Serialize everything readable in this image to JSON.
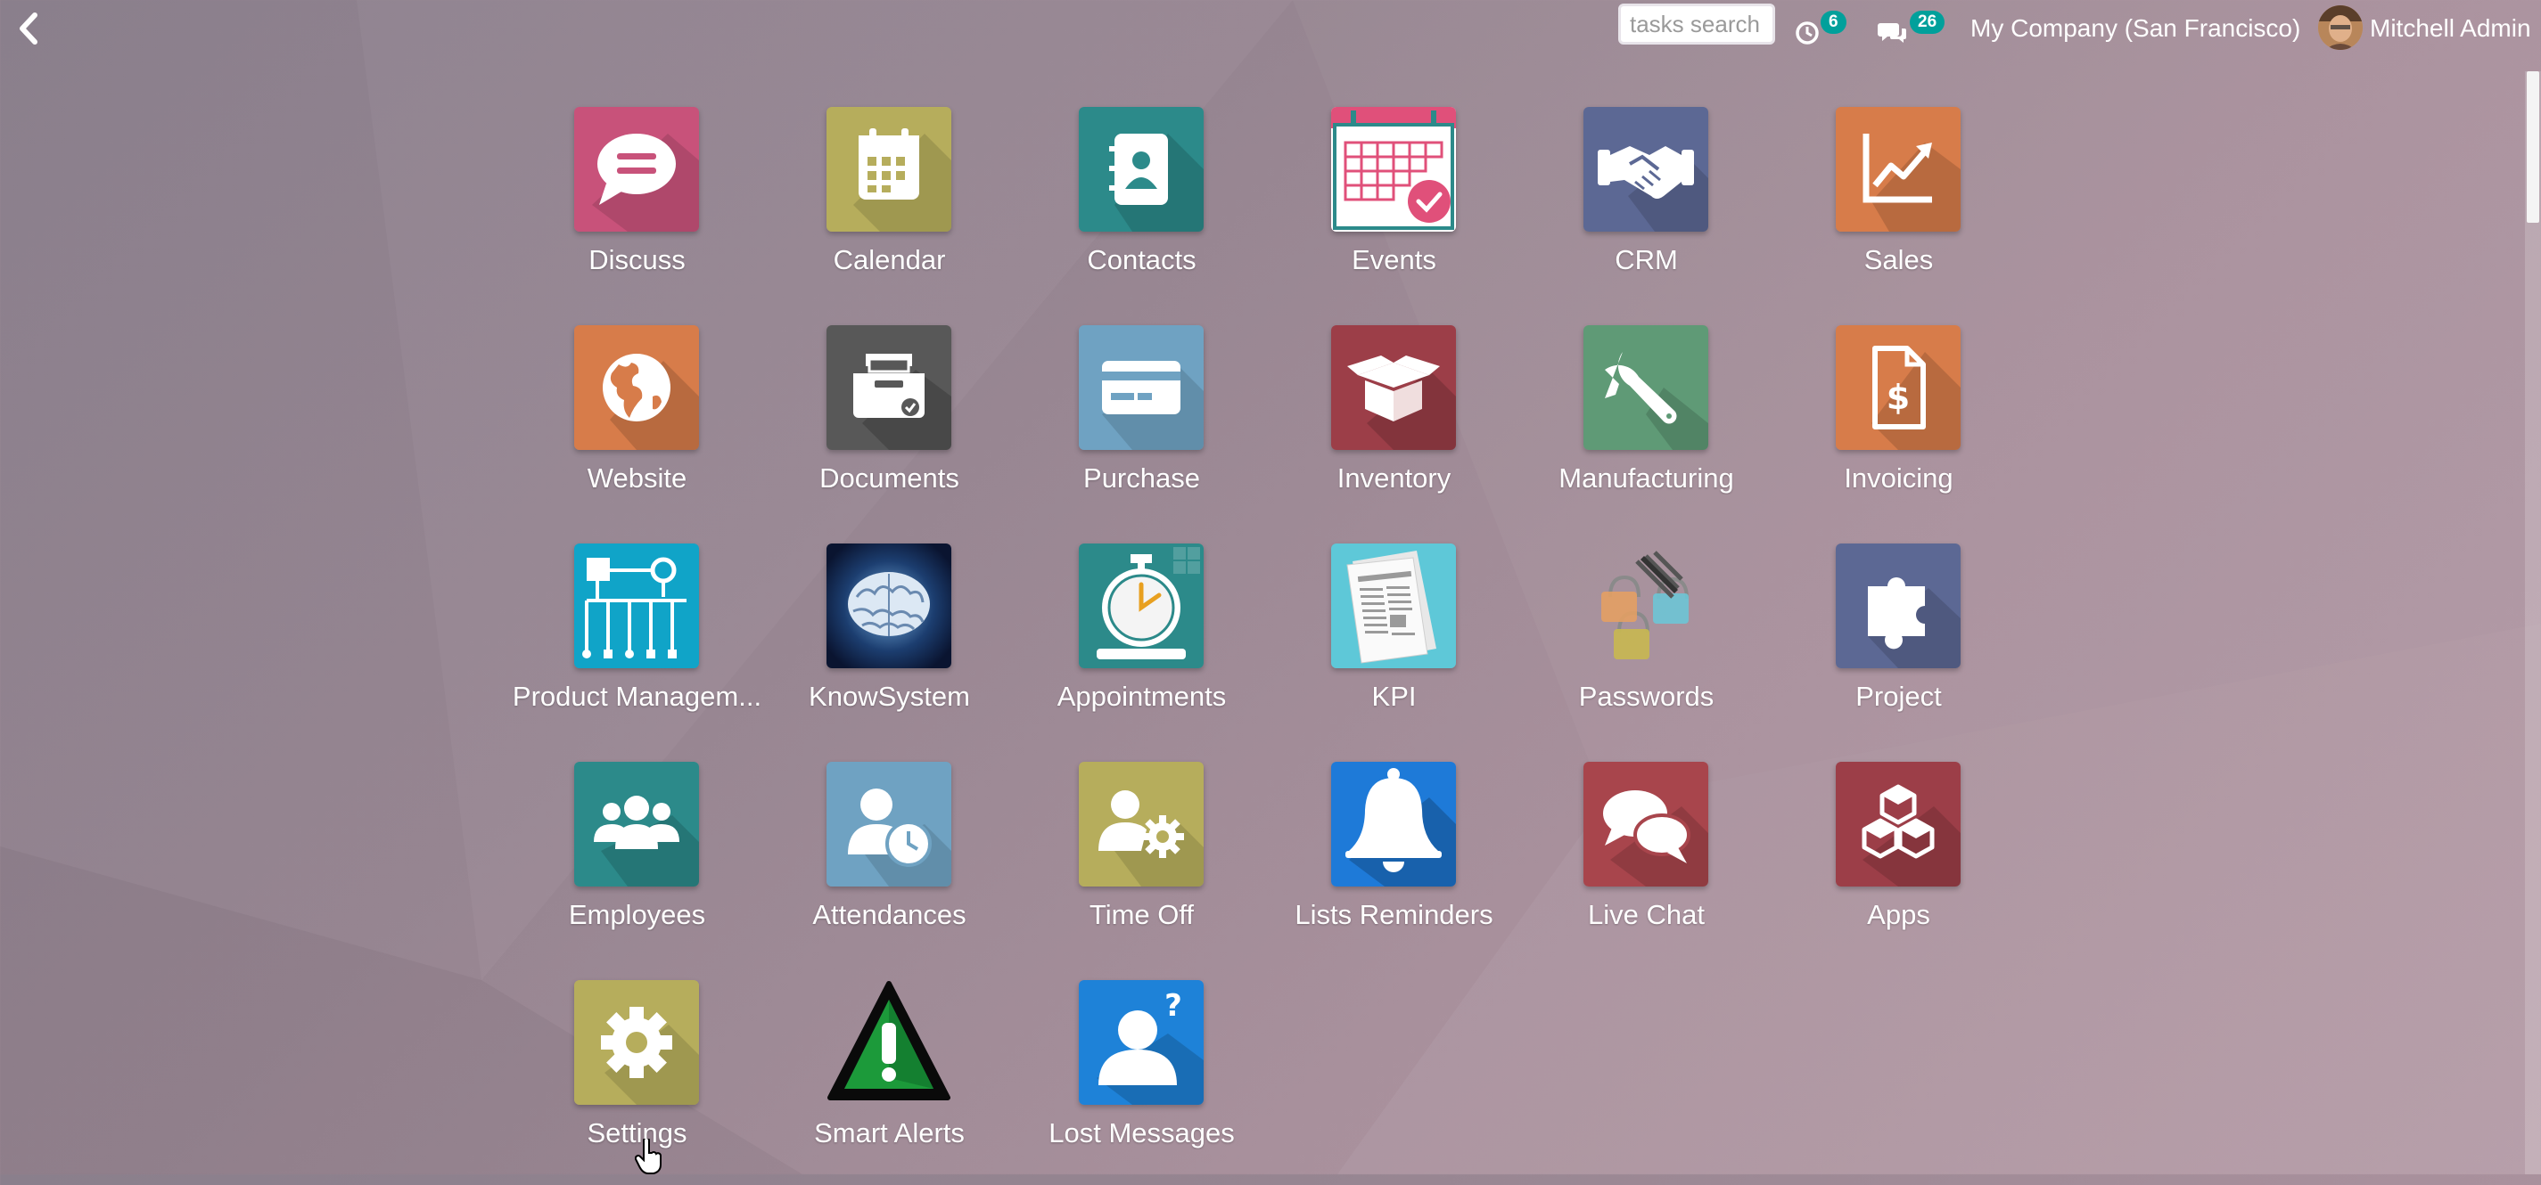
{
  "topbar": {
    "back_icon": "chevron-left-icon",
    "search": {
      "placeholder": "tasks search",
      "value": ""
    },
    "activity": {
      "icon": "clock-icon",
      "count": "6"
    },
    "messages": {
      "icon": "chat-bubbles-icon",
      "count": "26"
    },
    "company": "My Company (San Francisco)",
    "user": "Mitchell Admin"
  },
  "apps": [
    {
      "label": "Discuss",
      "icon": "chat-bubble-icon",
      "color": "#c8527a"
    },
    {
      "label": "Calendar",
      "icon": "calendar-icon",
      "color": "#b6ad5c"
    },
    {
      "label": "Contacts",
      "icon": "address-book-icon",
      "color": "#2c8a8a"
    },
    {
      "label": "Events",
      "icon": "event-calendar-icon",
      "color": "#ffffff"
    },
    {
      "label": "CRM",
      "icon": "handshake-icon",
      "color": "#5c6894"
    },
    {
      "label": "Sales",
      "icon": "trend-chart-icon",
      "color": "#d77c4a"
    },
    {
      "label": "Website",
      "icon": "globe-icon",
      "color": "#d77c4a"
    },
    {
      "label": "Documents",
      "icon": "inbox-tray-icon",
      "color": "#585858"
    },
    {
      "label": "Purchase",
      "icon": "credit-card-icon",
      "color": "#6fa2c2"
    },
    {
      "label": "Inventory",
      "icon": "box-icon",
      "color": "#9c3e48"
    },
    {
      "label": "Manufacturing",
      "icon": "wrench-icon",
      "color": "#5f9a76"
    },
    {
      "label": "Invoicing",
      "icon": "invoice-dollar-icon",
      "color": "#d77c4a"
    },
    {
      "label": "Product Managem...",
      "icon": "org-chart-icon",
      "color": "#10a4c8"
    },
    {
      "label": "KnowSystem",
      "icon": "brain-icon",
      "color": "#0c1c3a"
    },
    {
      "label": "Appointments",
      "icon": "stopwatch-icon",
      "color": "#2c8a8a"
    },
    {
      "label": "KPI",
      "icon": "newspaper-icon",
      "color": "#5ec8d8"
    },
    {
      "label": "Passwords",
      "icon": "padlocks-icon",
      "color": "transparent"
    },
    {
      "label": "Project",
      "icon": "puzzle-icon",
      "color": "#5c6894"
    },
    {
      "label": "Employees",
      "icon": "users-icon",
      "color": "#2c8a8a"
    },
    {
      "label": "Attendances",
      "icon": "user-clock-icon",
      "color": "#6fa2c2"
    },
    {
      "label": "Time Off",
      "icon": "user-gear-icon",
      "color": "#b6ad5c"
    },
    {
      "label": "Lists Reminders",
      "icon": "bell-icon",
      "color": "#1e7ad8"
    },
    {
      "label": "Live Chat",
      "icon": "chat-bubbles-icon",
      "color": "#a8454c"
    },
    {
      "label": "Apps",
      "icon": "cubes-icon",
      "color": "#9c3e48"
    },
    {
      "label": "Settings",
      "icon": "gear-icon",
      "color": "#b6ad5c"
    },
    {
      "label": "Smart Alerts",
      "icon": "warning-triangle-icon",
      "color": "#1c9a3a"
    },
    {
      "label": "Lost Messages",
      "icon": "user-question-icon",
      "color": "#1e82d8"
    }
  ]
}
